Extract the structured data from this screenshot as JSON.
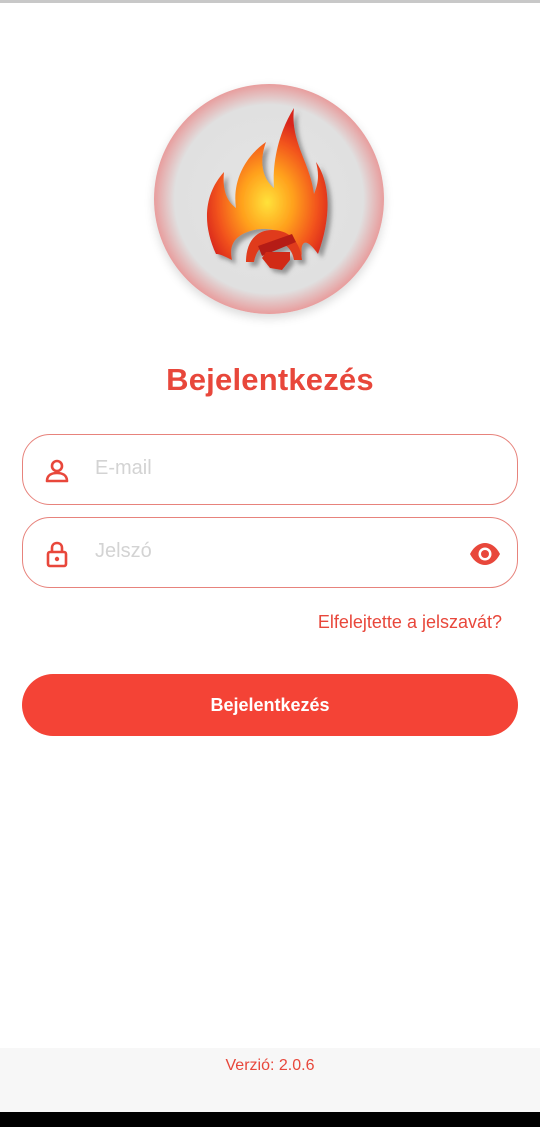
{
  "app": {
    "logo_icon": "flame-firefighter-helmet-logo",
    "accent_color": "#f44336"
  },
  "login": {
    "title": "Bejelentkezés",
    "email_placeholder": "E-mail",
    "password_placeholder": "Jelszó",
    "email_icon": "person-icon",
    "password_icon": "lock-icon",
    "visibility_icon": "eye-icon",
    "forgot_password": "Elfelejtette a jelszavát?",
    "submit_label": "Bejelentkezés"
  },
  "footer": {
    "version": "Verzió: 2.0.6"
  }
}
